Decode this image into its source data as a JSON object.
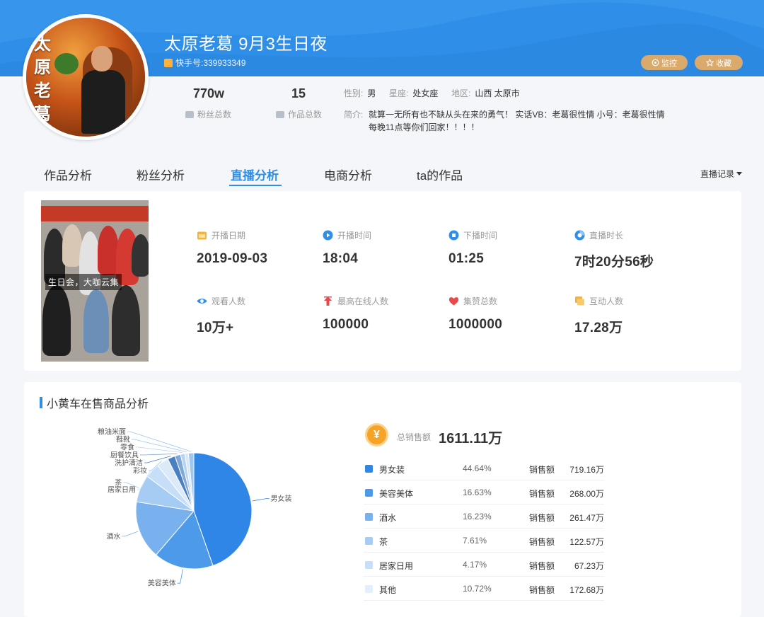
{
  "profile": {
    "name": "太原老葛 9月3生日夜",
    "kuaishou_id": "快手号:339933349",
    "avatar_text": [
      "太",
      "原",
      "老",
      "葛"
    ],
    "followers": "770w",
    "followers_label": "粉丝总数",
    "works": "15",
    "works_label": "作品总数",
    "gender_label": "性别:",
    "gender": "男",
    "zodiac_label": "星座:",
    "zodiac": "处女座",
    "region_label": "地区:",
    "region": "山西 太原市",
    "bio_label": "简介:",
    "bio": "就算一无所有也不缺从头在来的勇气！ 实话VB：老葛很性情 小号：老葛很性情 每晚11点等你们回家！！！！",
    "monitor_label": "监控",
    "favorite_label": "收藏"
  },
  "tabs": [
    {
      "label": "作品分析",
      "active": false
    },
    {
      "label": "粉丝分析",
      "active": false
    },
    {
      "label": "直播分析",
      "active": true
    },
    {
      "label": "电商分析",
      "active": false
    },
    {
      "label": "ta的作品",
      "active": false
    }
  ],
  "dropdown": {
    "label": "直播记录"
  },
  "live": {
    "thumbnail_caption": "生日会，大咖云集",
    "stats": [
      {
        "label": "开播日期",
        "value": "2019-09-03",
        "icon": "calendar-icon",
        "color": "#f5a623"
      },
      {
        "label": "开播时间",
        "value": "18:04",
        "icon": "play-icon",
        "color": "#2f8fe8"
      },
      {
        "label": "下播时间",
        "value": "01:25",
        "icon": "stop-icon",
        "color": "#2f8fe8"
      },
      {
        "label": "直播时长",
        "value": "7时20分56秒",
        "icon": "clock-icon",
        "color": "#2f8fe8"
      },
      {
        "label": "观看人数",
        "value": "10万+",
        "icon": "eye-icon",
        "color": "#2f8fe8"
      },
      {
        "label": "最高在线人数",
        "value": "100000",
        "icon": "peak-icon",
        "color": "#e8494a"
      },
      {
        "label": "集赞总数",
        "value": "1000000",
        "icon": "heart-icon",
        "color": "#e8494a"
      },
      {
        "label": "互动人数",
        "value": "17.28万",
        "icon": "chat-icon",
        "color": "#f5a623"
      }
    ]
  },
  "sales": {
    "section_title": "小黄车在售商品分析",
    "currency_symbol": "¥",
    "total_label": "总销售额",
    "total_value": "1611.11万",
    "amount_label": "销售额",
    "rows": [
      {
        "name": "男女装",
        "pct": "44.64%",
        "amount": "719.16万",
        "color": "#2f86e6"
      },
      {
        "name": "美容美体",
        "pct": "16.63%",
        "amount": "268.00万",
        "color": "#4d99ea"
      },
      {
        "name": "酒水",
        "pct": "16.23%",
        "amount": "261.47万",
        "color": "#79b1ef"
      },
      {
        "name": "茶",
        "pct": "7.61%",
        "amount": "122.57万",
        "color": "#a6ccf4"
      },
      {
        "name": "居家日用",
        "pct": "4.17%",
        "amount": "67.23万",
        "color": "#c6def8"
      },
      {
        "name": "其他",
        "pct": "10.72%",
        "amount": "172.68万",
        "color": "#e2eefb"
      }
    ]
  },
  "chart_data": {
    "type": "pie",
    "title": "",
    "slices": [
      {
        "label": "男女装",
        "value": 44.64,
        "color": "#2f86e6"
      },
      {
        "label": "美容美体",
        "value": 16.63,
        "color": "#4d99ea"
      },
      {
        "label": "酒水",
        "value": 16.23,
        "color": "#79b1ef"
      },
      {
        "label": "茶",
        "value": 7.61,
        "color": "#a6ccf4"
      },
      {
        "label": "居家日用",
        "value": 4.17,
        "color": "#c6def8"
      },
      {
        "label": "彩妆",
        "value": 3.3,
        "color": "#dbe9f9"
      },
      {
        "label": "洗护清洁",
        "value": 2.1,
        "color": "#4a80c0"
      },
      {
        "label": "厨餐饮具",
        "value": 1.6,
        "color": "#7fa8d8"
      },
      {
        "label": "零食",
        "value": 1.2,
        "color": "#b7d3f0"
      },
      {
        "label": "鞋靴",
        "value": 1.0,
        "color": "#d7e7f8"
      },
      {
        "label": "粮油米面",
        "value": 1.5,
        "color": "#9ec7ee"
      }
    ]
  }
}
